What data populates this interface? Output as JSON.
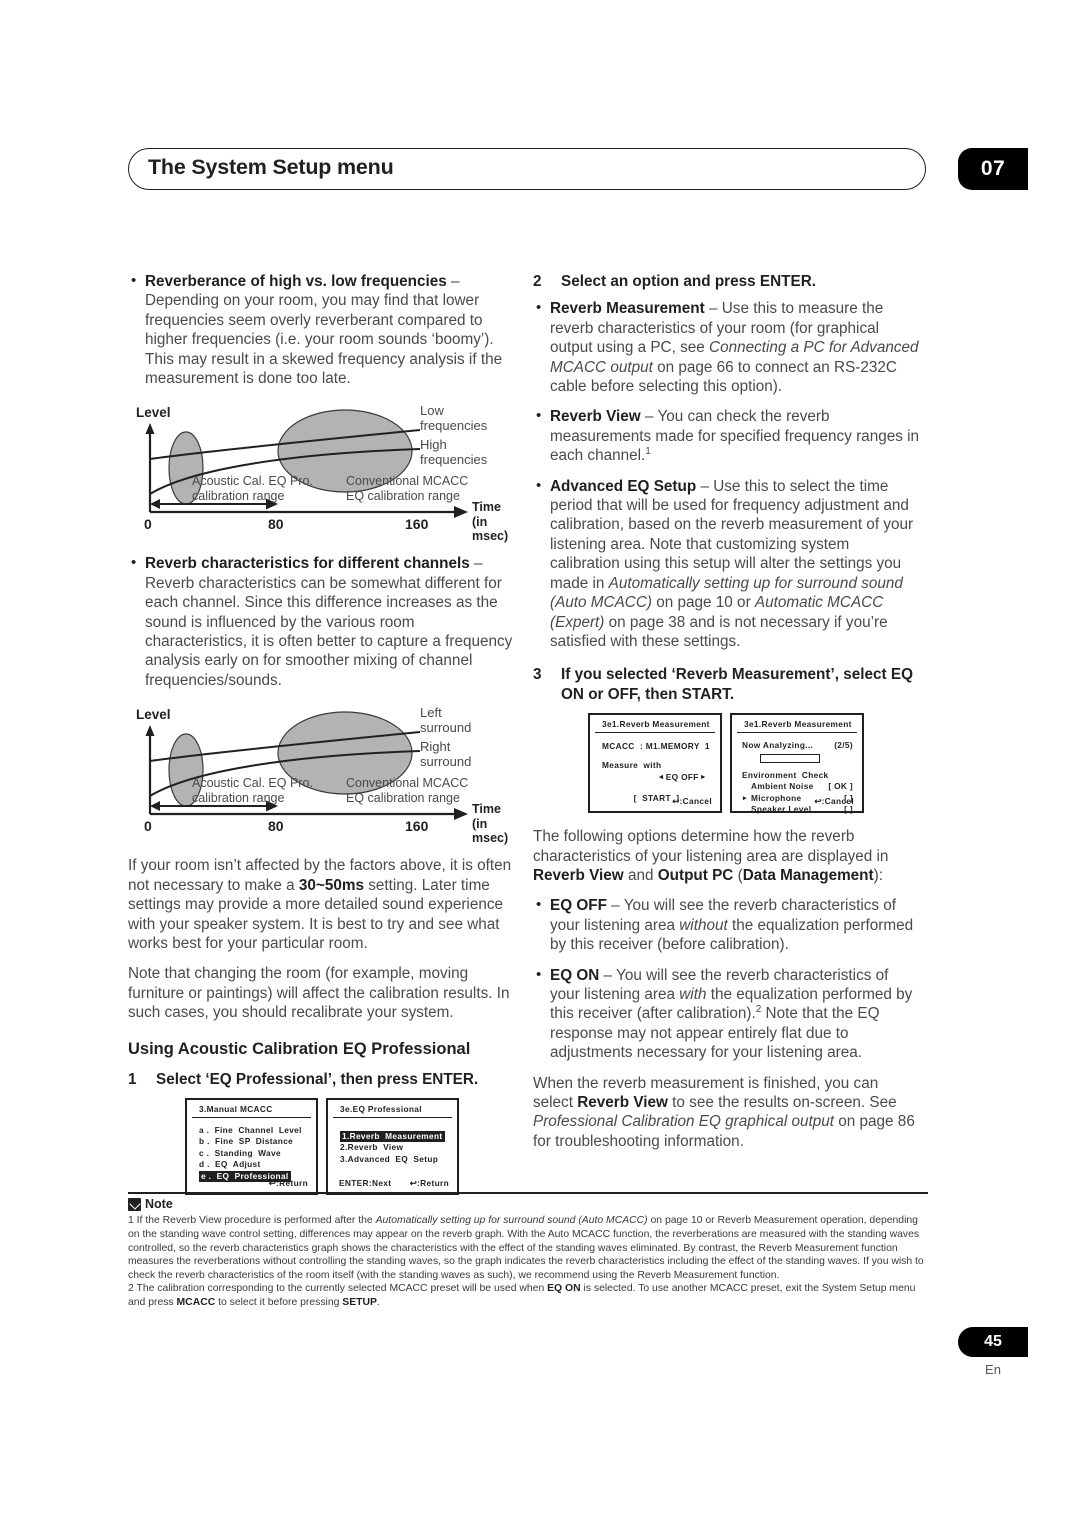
{
  "header": {
    "title": "The System Setup menu",
    "chapter": "07"
  },
  "footer": {
    "page_number": "45",
    "language": "En"
  },
  "left_column": {
    "bullet1": {
      "lead": "Reverberance of high vs. low frequencies",
      "dash": " – ",
      "body": "Depending on your room, you may find that lower frequencies seem overly reverberant compared to higher frequencies (i.e. your room sounds ‘boomy’). This may result in a skewed frequency analysis if the measurement is done too late."
    },
    "diagram1": {
      "y_axis_label": "Level",
      "x_axis_label": "Time",
      "x_axis_unit": "(in msec)",
      "ticks": [
        "0",
        "80",
        "160"
      ],
      "curve_label_top": "Low",
      "curve_label_top2": "frequencies",
      "curve_label_bottom": "High",
      "curve_label_bottom2": "frequencies",
      "region_small": "Acoustic Cal. EQ Pro.",
      "region_small2": "calibration range",
      "region_large": "Conventional MCACC",
      "region_large2": "EQ calibration range"
    },
    "bullet2": {
      "lead": "Reverb characteristics for different channels",
      "dash": " – ",
      "body": "Reverb characteristics can be somewhat different for each channel. Since this difference increases as the sound is influenced by the various room characteristics, it is often better to capture a frequency analysis early on for smoother mixing of channel frequencies/sounds."
    },
    "diagram2": {
      "y_axis_label": "Level",
      "x_axis_label": "Time",
      "x_axis_unit": "(in msec)",
      "ticks": [
        "0",
        "80",
        "160"
      ],
      "curve_label_top": "Left",
      "curve_label_top2": "surround",
      "curve_label_bottom": "Right",
      "curve_label_bottom2": "surround",
      "region_small": "Acoustic Cal. EQ Pro.",
      "region_small2": "calibration range",
      "region_large": "Conventional MCACC",
      "region_large2": "EQ calibration range"
    },
    "para1_a": "If your room isn’t affected by the factors above, it is often not necessary to make a ",
    "para1_bold": "30~50ms",
    "para1_b": " setting. Later time settings may provide a more detailed sound experience with your speaker system. It is best to try and see what works best for your particular room.",
    "para2": "Note that changing the room (for example, moving furniture or paintings) will affect the calibration results. In such cases, you should recalibrate your system.",
    "section_heading": "Using Acoustic Calibration EQ Professional",
    "step1": {
      "num": "1",
      "text": "Select ‘EQ Professional’, then press ENTER."
    },
    "osd_left": {
      "title": "3.Manual  MCACC",
      "items": [
        "a .  Fine  Channel  Level",
        "b .  Fine  SP  Distance",
        "c .  Standing  Wave",
        "d .  EQ  Adjust"
      ],
      "highlighted": "e .  EQ  Professional",
      "footer_right": "↩:Return"
    },
    "osd_right": {
      "title": "3e.EQ  Professional",
      "highlighted": "1.Reverb  Measurement",
      "items": [
        "2.Reverb  View",
        "3.Advanced  EQ  Setup"
      ],
      "footer_left": "ENTER:Next",
      "footer_right": "↩:Return"
    }
  },
  "right_column": {
    "step2": {
      "num": "2",
      "text": "Select an option and press ENTER."
    },
    "bullet1": {
      "lead": "Reverb Measurement",
      "dash": " – ",
      "body_a": "Use this to measure the reverb characteristics of your room (for graphical output using a PC, see ",
      "body_i": "Connecting a PC for Advanced MCACC output",
      "body_b": " on page 66 to connect an RS-232C cable before selecting this option)."
    },
    "bullet2": {
      "lead": "Reverb View",
      "dash": " – ",
      "body": "You can check the reverb measurements made for specified frequency ranges in each channel.",
      "footnote": "1"
    },
    "bullet3": {
      "lead": "Advanced EQ Setup",
      "dash": " – ",
      "body_a": "Use this to select the time period that will be used for frequency adjustment and calibration, based on the reverb measurement of your listening area. Note that customizing system calibration using this setup will alter the settings you made in ",
      "body_i1": "Automatically setting up for surround sound (Auto MCACC)",
      "body_b": " on page 10 or ",
      "body_i2": "Automatic MCACC (Expert)",
      "body_c": " on page 38 and is not necessary if you’re satisfied with these settings."
    },
    "step3": {
      "num": "3",
      "text": "If you selected ‘Reverb Measurement’, select EQ ON or OFF, then START."
    },
    "osd_left": {
      "title": "3e1.Reverb Measurement",
      "line1": "MCACC  : M1.MEMORY  1",
      "line2": "Measure  with",
      "selector_left": "◄",
      "selector_value": "EQ  OFF",
      "selector_right": "►",
      "start_button": "[  START  ]",
      "footer_right": "↩:Cancel"
    },
    "osd_right": {
      "title": "3e1.Reverb  Measurement",
      "analyzing": "Now  Analyzing...",
      "progress": "(2/5)",
      "check_title": "Environment  Check",
      "rows": [
        {
          "label": "Ambient  Noise",
          "value": "[  OK  ]",
          "marker": ""
        },
        {
          "label": "Microphone",
          "value": "[      ]",
          "marker": "▸"
        },
        {
          "label": "Speaker  Level",
          "value": "[      ]",
          "marker": ""
        }
      ],
      "footer_right": "↩:Cancel"
    },
    "para_intro_a": "The following options determine how the reverb characteristics of your listening area are displayed in ",
    "para_intro_b1": "Reverb View",
    "para_intro_c": " and ",
    "para_intro_b2": "Output PC",
    "para_intro_d": " (",
    "para_intro_b3": "Data Management",
    "para_intro_e": "):",
    "bullet4": {
      "lead": "EQ OFF",
      "dash": " – ",
      "body_a": "You will see the reverb characteristics of your listening area ",
      "body_i": "without",
      "body_b": " the equalization performed by this receiver (before calibration)."
    },
    "bullet5": {
      "lead": "EQ ON",
      "dash": " – ",
      "body_a": "You will see the reverb characteristics of your listening area ",
      "body_i": "with",
      "body_b": " the equalization performed by this receiver (after calibration).",
      "footnote": "2",
      "body_c": " Note that the EQ response may not appear entirely flat due to adjustments necessary for your listening area."
    },
    "para_end_a": "When the reverb measurement is finished, you can select ",
    "para_end_b": "Reverb View",
    "para_end_c": " to see the results on-screen. See ",
    "para_end_i": "Professional Calibration EQ graphical output",
    "para_end_d": " on page 86 for troubleshooting information."
  },
  "note": {
    "title": "Note",
    "item1_a": "1 If the Reverb View procedure is performed after the ",
    "item1_i": "Automatically setting up for surround sound (Auto MCACC)",
    "item1_b": " on page 10 or Reverb Measurement operation, depending on the standing wave control setting, differences may appear on the reverb graph. With the Auto MCACC function, the reverberations are measured with the standing waves controlled, so the reverb characteristics graph shows the characteristics with the effect of the standing waves eliminated. By contrast, the Reverb Measurement function measures the reverberations without controlling the standing waves, so the graph indicates the reverb characteristics including the effect of the standing waves. If you wish to check the reverb characteristics of the room itself (with the standing waves as such), we recommend using the Reverb Measurement function.",
    "item2_a": "2 The calibration corresponding to the currently selected MCACC preset will be used when ",
    "item2_b1": "EQ ON",
    "item2_b": " is selected. To use another MCACC preset, exit the System Setup menu and press ",
    "item2_b2": "MCACC",
    "item2_c": " to select it before pressing ",
    "item2_b3": "SETUP",
    "item2_d": "."
  },
  "colors": {
    "ink": "#231f20",
    "body_text": "#4a4a4a",
    "diagram_fill": "#b3b3b3"
  }
}
